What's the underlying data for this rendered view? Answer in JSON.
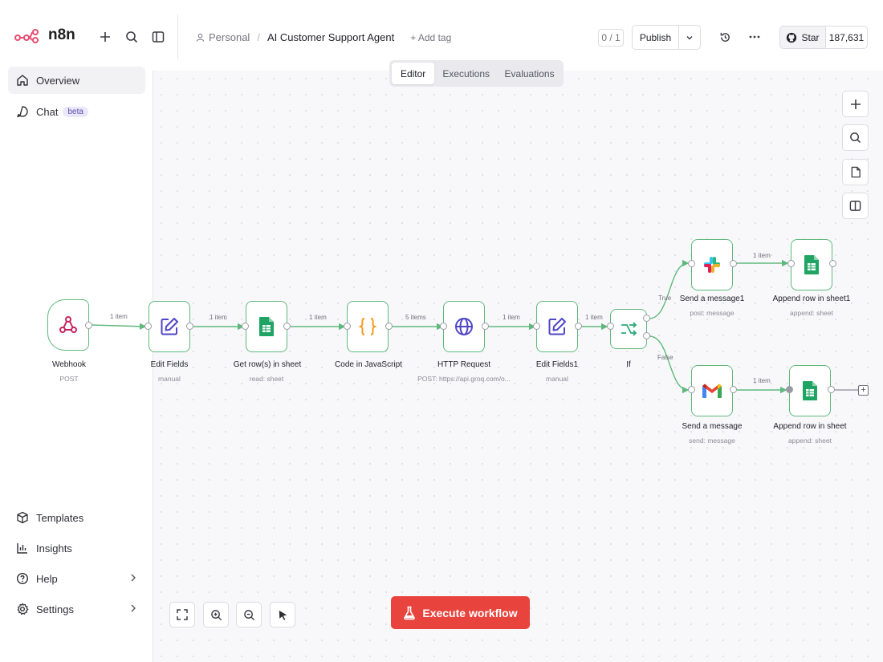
{
  "app": {
    "name": "n8n"
  },
  "breadcrumb": {
    "project": "Personal",
    "separator": "/",
    "workflow": "AI Customer Support Agent",
    "add_tag": "+ Add tag"
  },
  "header": {
    "counter": "0 / 1",
    "publish": "Publish",
    "github_star": "Star",
    "github_count": "187,631"
  },
  "sidebar": {
    "overview": "Overview",
    "chat": "Chat",
    "chat_badge": "beta",
    "templates": "Templates",
    "insights": "Insights",
    "help": "Help",
    "settings": "Settings"
  },
  "tabs": [
    "Editor",
    "Executions",
    "Evaluations"
  ],
  "execute": "Execute workflow",
  "nodes": {
    "webhook": {
      "name": "Webhook",
      "sub": "POST"
    },
    "edit_fields": {
      "name": "Edit Fields",
      "sub": "manual"
    },
    "get_rows": {
      "name": "Get row(s) in sheet",
      "sub": "read: sheet"
    },
    "code": {
      "name": "Code in JavaScript",
      "sub": ""
    },
    "http": {
      "name": "HTTP Request",
      "sub": "POST: https://api.groq.com/o..."
    },
    "edit_fields1": {
      "name": "Edit Fields1",
      "sub": "manual"
    },
    "if": {
      "name": "If",
      "sub": ""
    },
    "send_message1": {
      "name": "Send a message1",
      "sub": "post: message"
    },
    "append_row1": {
      "name": "Append row in sheet1",
      "sub": "append: sheet"
    },
    "send_message": {
      "name": "Send a message",
      "sub": "send: message"
    },
    "append_row": {
      "name": "Append row in sheet",
      "sub": "append: sheet"
    }
  },
  "edges": {
    "e1": "1 item",
    "e2": "1 item",
    "e3": "1 item",
    "e4": "5 items",
    "e5": "1 item",
    "e6": "1 item",
    "true": "True",
    "false": "False",
    "e7": "1 item",
    "e8": "1 item"
  },
  "colors": {
    "accent": "#e8433d",
    "edge": "#5fb97c",
    "brand": "#ea4b71"
  }
}
